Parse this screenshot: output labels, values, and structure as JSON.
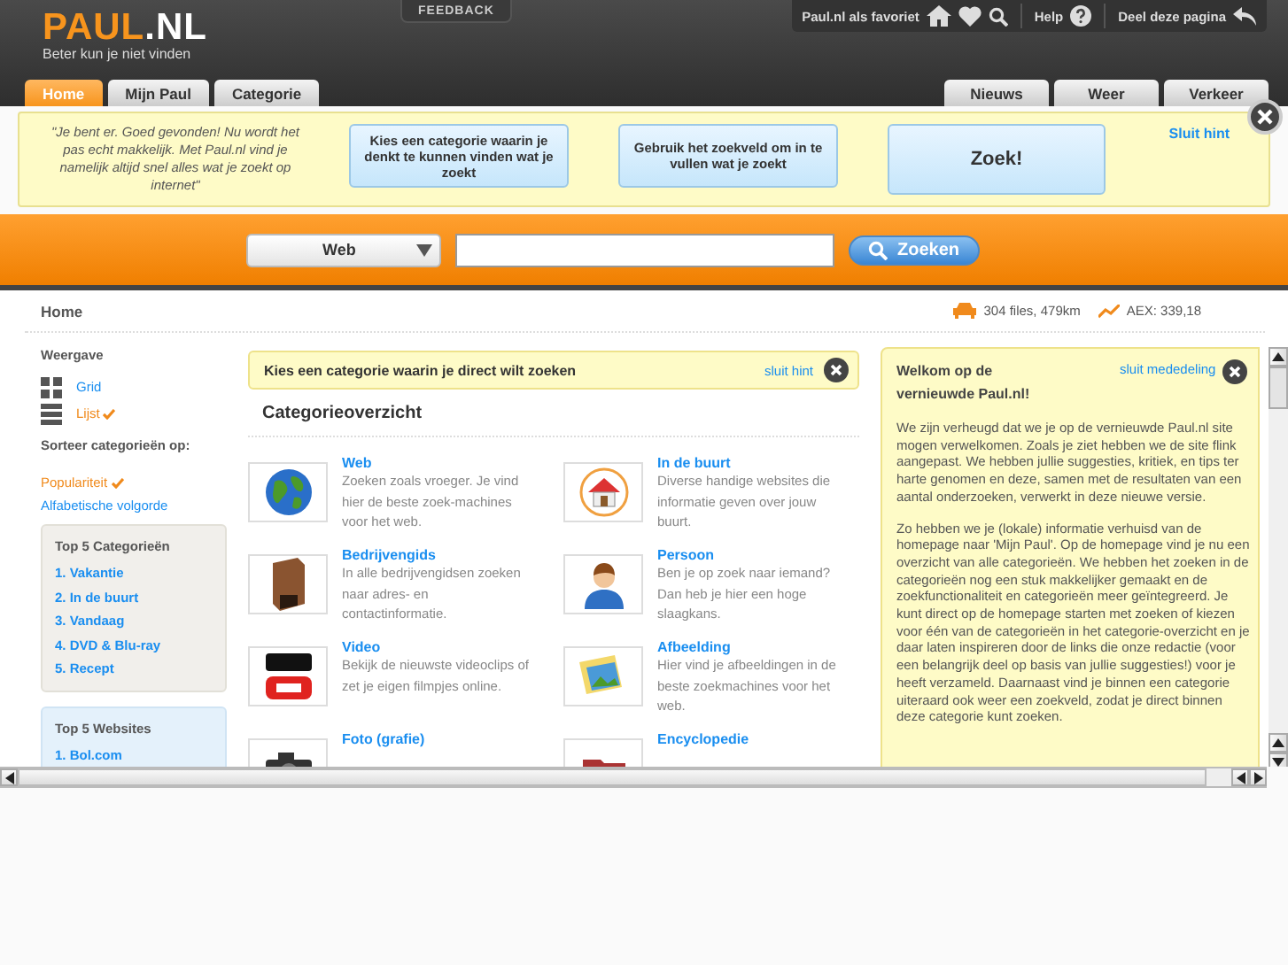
{
  "logo": {
    "main": "PAUL",
    "suffix": ".NL",
    "tagline": "Beter kun je niet vinden"
  },
  "feedback": "FEEDBACK",
  "top_links": [
    {
      "kind": "favorite",
      "label": "Paul.nl als favoriet"
    },
    {
      "kind": "help",
      "label": "Help"
    },
    {
      "kind": "share",
      "label": "Deel deze pagina"
    }
  ],
  "tabs_left": [
    {
      "label": "Home",
      "selected": true
    },
    {
      "label": "Mijn Paul",
      "selected": false
    },
    {
      "label": "Categorie",
      "selected": false
    }
  ],
  "tabs_right": [
    {
      "label": "Nieuws",
      "selected": false
    },
    {
      "label": "Weer",
      "selected": false
    },
    {
      "label": "Verkeer",
      "selected": false
    }
  ],
  "hint": {
    "quote": "\"Je bent er. Goed gevonden! Nu wordt het pas echt makkelijk. Met Paul.nl vind je namelijk altijd snel alles wat je zoekt op internet\"",
    "steps": [
      {
        "kind": "text",
        "text": "Kies een categorie waarin je denkt te kunnen vinden wat je zoekt"
      },
      {
        "kind": "text",
        "text": "Gebruik het zoekveld om in te vullen wat je zoekt"
      },
      {
        "kind": "action",
        "text": "Zoek!"
      }
    ],
    "close_label": "Sluit hint"
  },
  "search": {
    "scope": "Web",
    "button": "Zoeken"
  },
  "breadcrumb": "Home",
  "status": [
    {
      "kind": "traffic",
      "text": "304 files, 479km"
    },
    {
      "kind": "stocks",
      "text": "AEX: 339,18"
    }
  ],
  "sidebar": {
    "view_title": "Weergave",
    "views": [
      {
        "kind": "grid",
        "label": "Grid",
        "selected": false
      },
      {
        "kind": "list",
        "label": "Lijst",
        "selected": true
      }
    ],
    "sort_title": "Sorteer categorieën op:",
    "sorts": [
      {
        "label": "Populariteit",
        "selected": true
      },
      {
        "label": "Alfabetische volgorde",
        "selected": false
      }
    ],
    "top_categories": {
      "title": "Top 5 Categorieën",
      "items": [
        "1. Vakantie",
        "2. In de buurt",
        "3. Vandaag",
        "4. DVD & Blu-ray",
        "5. Recept"
      ]
    },
    "top_websites": {
      "title": "Top 5 Websites",
      "items": [
        "1. Bol.com"
      ]
    }
  },
  "category_hint": {
    "text": "Kies een categorie waarin je direct wilt zoeken",
    "close_label": "sluit hint"
  },
  "overview": {
    "title": "Categorieoverzicht",
    "categories": [
      {
        "kind": "globe",
        "title": "Web",
        "description": "Zoeken zoals vroeger. Je vind hier de beste zoek-machines voor het web."
      },
      {
        "kind": "house",
        "title": "In de buurt",
        "description": "Diverse handige websites die informatie geven over jouw buurt."
      },
      {
        "kind": "box",
        "title": "Bedrijvengids",
        "description": "In alle bedrijvengidsen zoeken naar adres- en contactinformatie."
      },
      {
        "kind": "person",
        "title": "Persoon",
        "description": "Ben je op zoek naar iemand? Dan heb je hier een hoge slaagkans."
      },
      {
        "kind": "video",
        "title": "Video",
        "description": "Bekijk de nieuwste videoclips of zet je eigen filmpjes online."
      },
      {
        "kind": "image",
        "title": "Afbeelding",
        "description": "Hier vind je afbeeldingen in de beste zoekmachines voor het web."
      },
      {
        "kind": "camera",
        "title": "Foto (grafie)"
      },
      {
        "kind": "book",
        "title": "Encyclopedie"
      }
    ]
  },
  "announcement": {
    "title": "Welkom op de vernieuwde Paul.nl!",
    "close_label": "sluit mededeling",
    "paragraphs": [
      "We zijn verheugd dat we je op de vernieuwde Paul.nl site mogen verwelkomen. Zoals je ziet hebben we de site flink aangepast. We hebben jullie suggesties, kritiek, en tips ter harte genomen en deze, samen met de resultaten van een aantal onderzoeken, verwerkt in deze nieuwe versie.",
      "Zo hebben we je (lokale) informatie verhuisd van de homepage naar 'Mijn Paul'. Op de homepage vind je nu een overzicht van alle categorieën. We hebben het zoeken in de categorieën nog een stuk makkelijker gemaakt en de zoekfunctionaliteit en categorieën meer geïntegreerd. Je kunt direct op de homepage starten met zoeken of kiezen voor één van de categorieën in het categorie-overzicht en je daar laten inspireren door de links die onze redactie (voor een belangrijk deel op basis van jullie suggesties!) voor je heeft verzameld. Daarnaast vind je binnen een categorie uiteraard ook weer een zoekveld, zodat je direct binnen deze categorie kunt zoeken."
    ]
  }
}
